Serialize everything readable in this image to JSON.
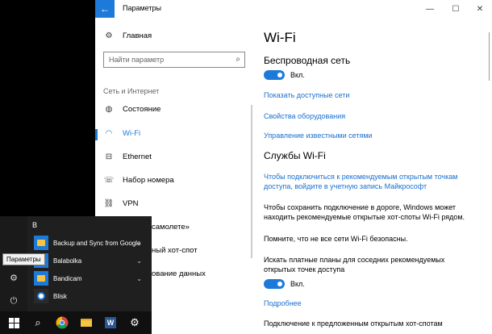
{
  "window": {
    "title": "Параметры",
    "back_glyph": "←",
    "minimize_glyph": "—",
    "maximize_glyph": "☐",
    "close_glyph": "✕"
  },
  "nav": {
    "home": "Главная",
    "search_placeholder": "Найти параметр",
    "category": "Сеть и Интернет",
    "items": [
      {
        "label": "Состояние",
        "icon": "globe-icon"
      },
      {
        "label": "Wi-Fi",
        "icon": "wifi-icon"
      },
      {
        "label": "Ethernet",
        "icon": "ethernet-icon"
      },
      {
        "label": "Набор номера",
        "icon": "dialup-icon"
      },
      {
        "label": "VPN",
        "icon": "vpn-icon"
      },
      {
        "label": "самолете»",
        "icon": "airplane-icon"
      },
      {
        "label": "ный хот-спот",
        "icon": "hotspot-icon"
      },
      {
        "label": "ование данных",
        "icon": "data-usage-icon"
      }
    ]
  },
  "main": {
    "title": "Wi-Fi",
    "wireless_heading": "Беспроводная сеть",
    "toggle1_label": "Вкл.",
    "link_show_networks": "Показать доступные сети",
    "link_hw_props": "Свойства оборудования",
    "link_manage_networks": "Управление известными сетями",
    "services_heading": "Службы Wi-Fi",
    "services_link_line1": "Чтобы подключиться к рекомендуемым открытым точкам",
    "services_link_line2": "доступа, войдите в учетную запись Майкрософт",
    "info_line1": "Чтобы сохранить подключение в дороге, Windows может",
    "info_line2": "находить рекомендуемые открытые хот-споты Wi-Fi рядом.",
    "reminder": "Помните, что не все сети Wi-Fi безопасны.",
    "paid_line1": "Искать платные планы для соседних рекомендуемых",
    "paid_line2": "открытых точек доступа",
    "toggle2_label": "Вкл.",
    "link_more": "Подробнее",
    "cut_text": "Подключение к предложенным открытым хот-спотам"
  },
  "start_menu": {
    "letter": "B",
    "apps": [
      {
        "label": "Backup and Sync from Google",
        "has_chevron": true,
        "tile": "folder"
      },
      {
        "label": "Balabolka",
        "has_chevron": true,
        "tile": "folder"
      },
      {
        "label": "Bandicam",
        "has_chevron": true,
        "tile": "folder"
      },
      {
        "label": "Blisk",
        "has_chevron": false,
        "tile": "blisk"
      }
    ],
    "tooltip": "Параметры"
  },
  "colors": {
    "accent": "#1e7ad8",
    "link": "#1a6fd0",
    "start_bg": "#1f1f1f",
    "taskbar_bg": "#101010"
  }
}
